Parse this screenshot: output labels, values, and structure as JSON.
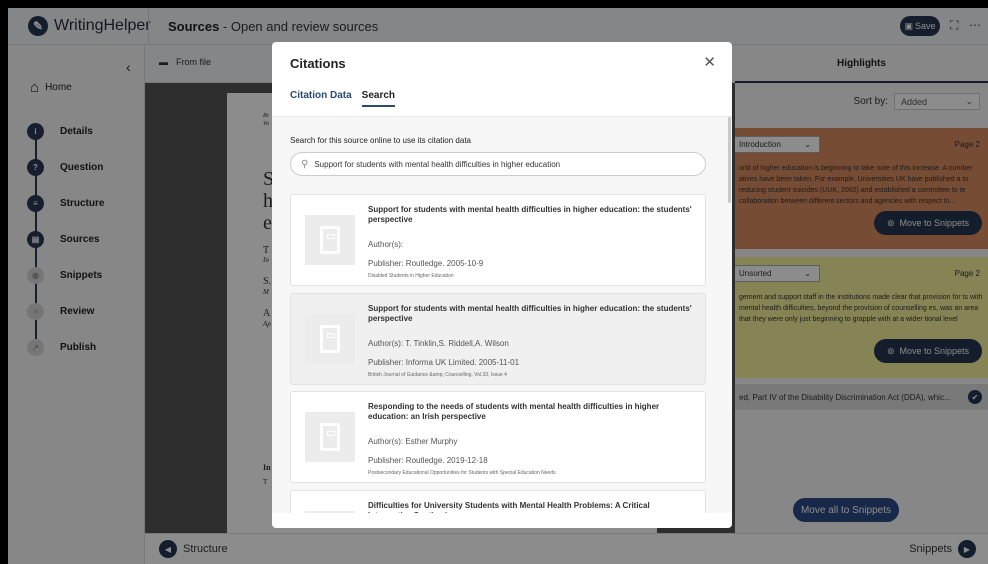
{
  "app": {
    "logo": "WritingHelper",
    "title_bold": "Sources",
    "title_rest": " - Open and review sources",
    "save_label": "Save"
  },
  "sidebar": {
    "home": "Home",
    "steps": [
      {
        "label": "Details",
        "icon": "info-icon"
      },
      {
        "label": "Question",
        "icon": "question-icon"
      },
      {
        "label": "Structure",
        "icon": "structure-icon"
      },
      {
        "label": "Sources",
        "icon": "sources-icon"
      },
      {
        "label": "Snippets",
        "icon": "snippets-icon"
      },
      {
        "label": "Review",
        "icon": "review-icon"
      },
      {
        "label": "Publish",
        "icon": "publish-icon"
      }
    ]
  },
  "document": {
    "from_file": "From file",
    "frag": {
      "a": "Br",
      "b": "Vo",
      "big1": "S",
      "big2": "h",
      "big3": "e",
      "l1": "T",
      "l2": "In",
      "l3": "S.",
      "l4": "M",
      "l5": "A",
      "l6": "Ap",
      "in": "In",
      "t": "T"
    }
  },
  "bottom": {
    "prev": "Structure",
    "next": "Snippets"
  },
  "highlights": {
    "title": "Highlights",
    "sort_label": "Sort by:",
    "sort_value": "Added",
    "cards": [
      {
        "tag": "Introduction",
        "page": "Page 2",
        "text": "orld of higher education is beginning to take note of this increase. A number atives have been taken. For example, Universities UK have published a to reducing student suicides (UUK, 2002) and established a committee to te collaboration between different sectors and agencies with respect to...",
        "move": "Move to Snippets",
        "color": "#d98a5f"
      },
      {
        "tag": "Unsorted",
        "page": "Page 2",
        "text": "gement and support staff in the institutions made clear that provision for ts with mental health difficulties, beyond the provision of counselling es, was an area that they were only just beginning to grapple with at a wider tional level",
        "move": "Move to Snippets",
        "color": "#f4f09b"
      }
    ],
    "collapsed_card": "ed, Part IV of the Disability Discrimination Act (DDA), whic...",
    "move_all": "Move all to Snippets"
  },
  "modal": {
    "title": "Citations",
    "tabs": [
      "Citation Data",
      "Search"
    ],
    "active_tab": "Search",
    "search_label": "Search for this source online to use its citation data",
    "search_value": "Support for students with mental health difficulties in higher education",
    "results": [
      {
        "title": "Support for students with mental health difficulties in higher education: the students' perspective",
        "authors": "Author(s):",
        "publisher": "Publisher: Routledge. 2005-10-9",
        "series": "Disabled Students in Higher Education"
      },
      {
        "title": "Support for students with mental health difficulties in higher education: the students' perspective",
        "authors": "Author(s): T. Tinklin,S. Riddell,A. Wilson",
        "publisher": "Publisher: Informa UK Limited. 2005-11-01",
        "series": "British Journal of Guidance &amp; Counselling, Vol.33, Issue 4"
      },
      {
        "title": "Responding to the needs of students with mental health difficulties in higher education: an Irish perspective",
        "authors": "Author(s): Esther Murphy",
        "publisher": "Publisher: Routledge. 2019-12-18",
        "series": "Postsecondary Educational Opportunities for Students with Special Education Needs"
      },
      {
        "title": "Difficulties for University Students with Mental Health Problems: A Critical Interpretive Synthesis",
        "authors": "",
        "publisher": "",
        "series": ""
      }
    ]
  }
}
